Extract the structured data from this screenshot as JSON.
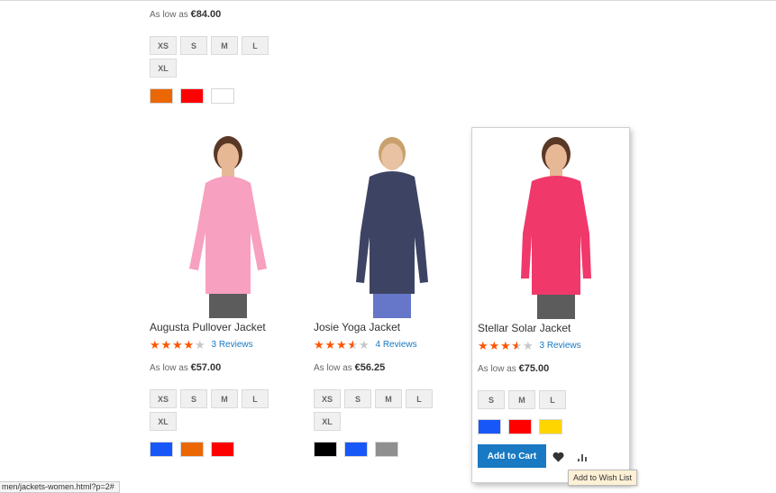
{
  "top_product": {
    "price_prefix": "As low as",
    "price": "€84.00",
    "sizes": [
      "XS",
      "S",
      "M",
      "L",
      "XL"
    ],
    "colors": [
      "#eb6703",
      "#ff0000",
      "#ffffff"
    ]
  },
  "products": [
    {
      "name": "Augusta Pullover Jacket",
      "rating_pct": 80,
      "reviews": "3 Reviews",
      "price_prefix": "As low as",
      "price": "€57.00",
      "sizes": [
        "XS",
        "S",
        "M",
        "L",
        "XL"
      ],
      "colors": [
        "#1857f7",
        "#eb6703",
        "#ff0000"
      ],
      "jacket_color": "#f7a0c0"
    },
    {
      "name": "Josie Yoga Jacket",
      "rating_pct": 70,
      "reviews": "4 Reviews",
      "price_prefix": "As low as",
      "price": "€56.25",
      "sizes": [
        "XS",
        "S",
        "M",
        "L",
        "XL"
      ],
      "colors": [
        "#000000",
        "#1857f7",
        "#8f8f8f"
      ],
      "jacket_color": "#3d4463"
    },
    {
      "name": "Stellar Solar Jacket",
      "rating_pct": 70,
      "reviews": "3 Reviews",
      "price_prefix": "As low as",
      "price": "€75.00",
      "sizes": [
        "S",
        "M",
        "L"
      ],
      "colors": [
        "#1857f7",
        "#ff0000",
        "#ffd500"
      ],
      "jacket_color": "#f0386b"
    }
  ],
  "actions": {
    "add_to_cart": "Add to Cart",
    "wishlist_icon": "heart-icon",
    "compare_icon": "bar-chart-icon"
  },
  "tooltip": "Add to Wish List",
  "status_url": "men/jackets-women.html?p=2#"
}
